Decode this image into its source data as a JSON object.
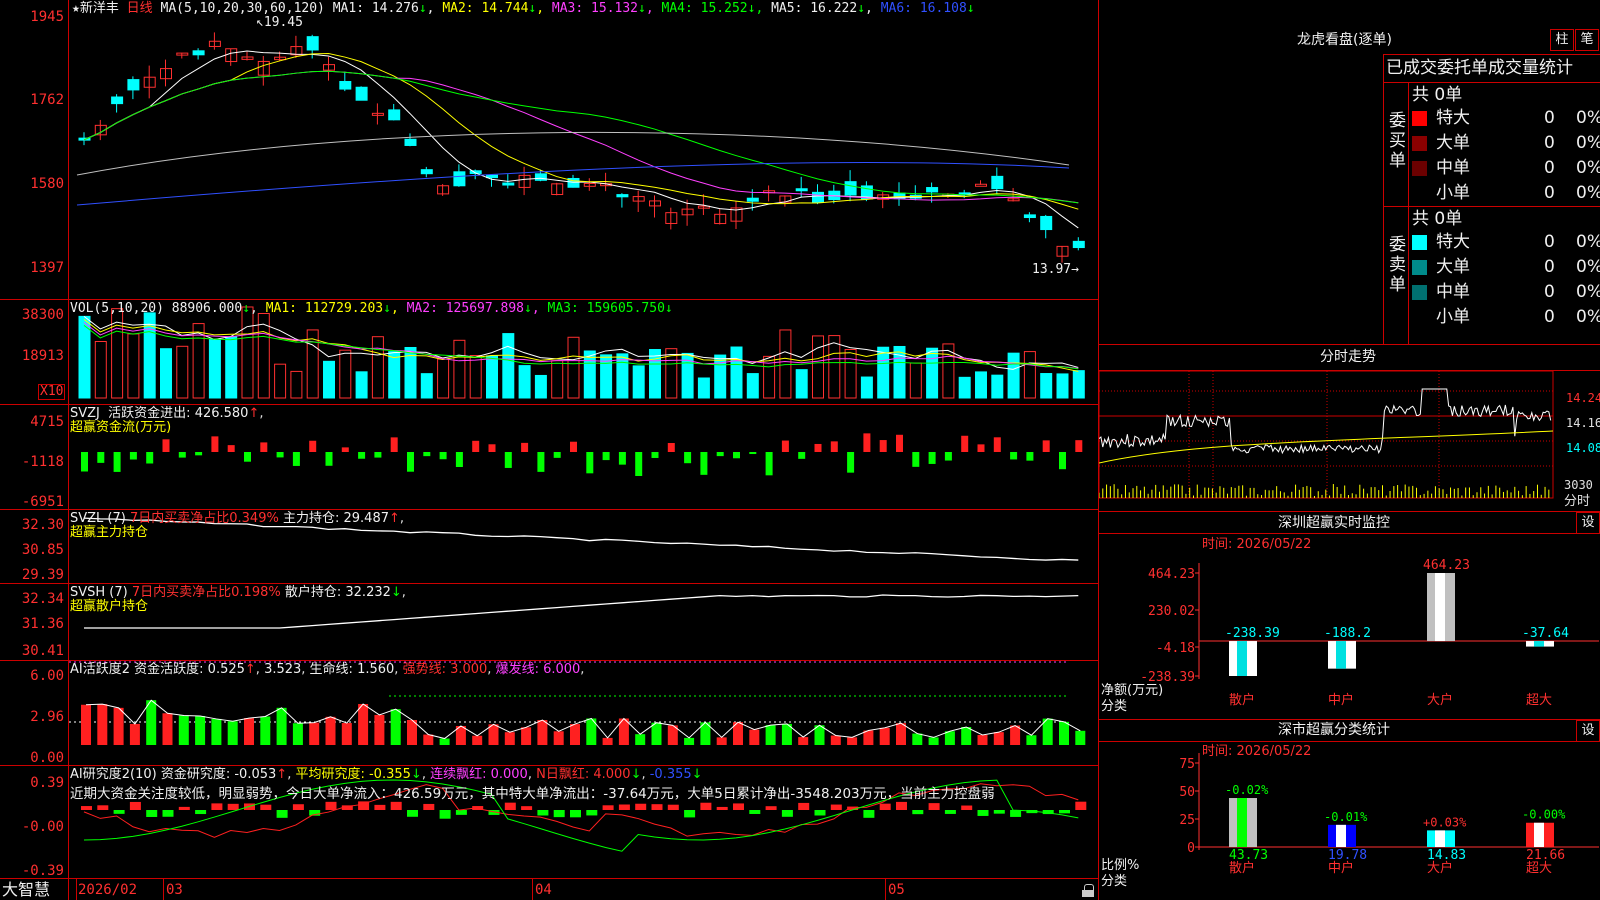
{
  "colors": {
    "up": "#ff3030",
    "down": "#00ffff",
    "grid": "#cc0000",
    "ma1": "#ffffff",
    "ma2": "#ffff00",
    "ma3": "#ff40ff",
    "ma4": "#00ff00",
    "ma5": "#c0c0c0",
    "ma6": "#3050ff"
  },
  "price_panel": {
    "star": "★",
    "name": "新洋丰",
    "period": "日线",
    "ma_label": "MA(5,10,20,30,60,120)",
    "ma": [
      {
        "label": "MA1:",
        "value": "14.276",
        "arrow": "↓"
      },
      {
        "label": "MA2:",
        "value": "14.744",
        "arrow": "↓"
      },
      {
        "label": "MA3:",
        "value": "15.132",
        "arrow": "↓"
      },
      {
        "label": "MA4:",
        "value": "15.252",
        "arrow": "↓"
      },
      {
        "label": "MA5:",
        "value": "16.222",
        "arrow": "↓"
      },
      {
        "label": "MA6:",
        "value": "16.108",
        "arrow": "↓"
      }
    ],
    "y_ticks": [
      "1945",
      "1762",
      "1580",
      "1397"
    ],
    "high_mark": "19.45",
    "low_mark": "13.97→"
  },
  "vol_panel": {
    "label": "VOL(5,10,20)",
    "value": "88906.000",
    "value_arrow": "↓",
    "ma": [
      {
        "label": "MA1:",
        "value": "112729.203",
        "arrow": "↓"
      },
      {
        "label": "MA2:",
        "value": "125697.898",
        "arrow": "↓"
      },
      {
        "label": "MA3:",
        "value": "159605.750",
        "arrow": "↓"
      }
    ],
    "y_ticks": [
      "38300",
      "18913"
    ],
    "unit": "X10"
  },
  "svzj_panel": {
    "label": "SVZJ",
    "field": "活跃资金进出:",
    "value": "426.580",
    "arrow": "↑",
    "subtitle": "超赢资金流(万元)",
    "y_ticks": [
      "4715",
      "-1118",
      "-6951"
    ]
  },
  "svzl_panel": {
    "label": "SVZL (7)",
    "ratio": "7日内买卖净占比0.349%",
    "field": "主力持仓:",
    "value": "29.487",
    "arrow": "↑",
    "subtitle": "超赢主力持仓",
    "y_ticks": [
      "32.30",
      "30.85",
      "29.39"
    ]
  },
  "svsh_panel": {
    "label": "SVSH (7)",
    "ratio": "7日内买卖净占比0.198%",
    "field": "散户持仓:",
    "value": "32.232",
    "arrow": "↓",
    "subtitle": "超赢散户持仓",
    "y_ticks": [
      "32.34",
      "31.36",
      "30.41"
    ]
  },
  "ai_active": {
    "label": "AI活跃度2",
    "field": "资金活跃度:",
    "value": "0.525",
    "arrow": "↑",
    "v2": "3.523",
    "field3": "生命线:",
    "v3": "1.560",
    "strong": "强势线: 3.000",
    "burst": "爆发线: 6.000",
    "y_ticks": [
      "6.00",
      "2.96",
      "0.00"
    ]
  },
  "ai_research": {
    "label": "AI研究度2(10)",
    "field": "资金研究度:",
    "value": "-0.053",
    "arrow": "↑",
    "field2": "平均研究度:",
    "v2": "-0.355",
    "a2": "↓",
    "field3": "连续飘红:",
    "v3": "0.000",
    "field4": "N日飘红:",
    "v4": "4.000",
    "a4": "↓",
    "v5": "-0.355",
    "a5": "↓",
    "comment": "近期大资金关注度较低，明显弱势，今日大单净流入：426.59万元，其中特大单净流出：-37.64万元，大单5日累计净出-3548.203万元，当前主力控盘弱",
    "y_ticks": [
      "0.39",
      "-0.00",
      "-0.39"
    ]
  },
  "date_axis": {
    "brand": "大智慧",
    "labels": [
      "2026/02",
      "03",
      "04",
      "05"
    ]
  },
  "lhb": {
    "title": "龙虎看盘(逐单)",
    "tab1": "柱",
    "tab2": "笔",
    "header": "已成交委托单成交量统计",
    "buy_group": "委买单",
    "sell_group": "委卖单",
    "buy_total": "共 0单",
    "sell_total": "共 0单",
    "buy_rows": [
      {
        "name": "特大",
        "count": "0",
        "pct": "0%",
        "color": "#ff0000"
      },
      {
        "name": "大单",
        "count": "0",
        "pct": "0%",
        "color": "#8b0000"
      },
      {
        "name": "中单",
        "count": "0",
        "pct": "0%",
        "color": "#6b0000"
      },
      {
        "name": "小单",
        "count": "0",
        "pct": "0%",
        "color": ""
      }
    ],
    "sell_rows": [
      {
        "name": "特大",
        "count": "0",
        "pct": "0%",
        "color": "#00ffff"
      },
      {
        "name": "大单",
        "count": "0",
        "pct": "0%",
        "color": "#008b8b"
      },
      {
        "name": "中单",
        "count": "0",
        "pct": "0%",
        "color": "#007070"
      },
      {
        "name": "小单",
        "count": "0",
        "pct": "0%",
        "color": ""
      }
    ]
  },
  "intraday": {
    "title": "分时走势",
    "y_ticks": [
      "14.24",
      "14.16",
      "14.08"
    ],
    "vol_tick": "3030",
    "vol_unit": "分时"
  },
  "sz_monitor": {
    "title": "深圳超赢实时监控",
    "set": "设",
    "time": "时间: 2026/05/22",
    "y_ticks": [
      "464.23",
      "230.02",
      "-4.18",
      "-238.39"
    ],
    "ylabel": "净额(万元)",
    "xlabel": "分类",
    "bars": [
      {
        "cat": "散户",
        "value": -238.39,
        "label": "-238.39"
      },
      {
        "cat": "中户",
        "value": -188.2,
        "label": "-188.2"
      },
      {
        "cat": "大户",
        "value": 464.23,
        "label": "464.23"
      },
      {
        "cat": "超大",
        "value": -37.64,
        "label": "-37.64"
      }
    ]
  },
  "sz_class": {
    "title": "深市超赢分类统计",
    "set": "设",
    "time": "时间: 2026/05/22",
    "y_ticks": [
      "75",
      "50",
      "25",
      "0"
    ],
    "ylabel": "比例%",
    "xlabel": "分类",
    "bars": [
      {
        "cat": "散户",
        "value": 43.73,
        "label": "43.73",
        "delta": "-0.02%"
      },
      {
        "cat": "中户",
        "value": 19.78,
        "label": "19.78",
        "delta": "-0.01%"
      },
      {
        "cat": "大户",
        "value": 14.83,
        "label": "14.83",
        "delta": "+0.03%"
      },
      {
        "cat": "超大",
        "value": 21.66,
        "label": "21.66",
        "delta": "-0.00%"
      }
    ]
  },
  "chart_data": [
    {
      "type": "line",
      "title": "新洋丰 日线",
      "y_range": [
        13.97,
        19.45
      ],
      "series": [
        {
          "name": "MA1",
          "values": [
            14.276
          ]
        },
        {
          "name": "MA2",
          "values": [
            14.744
          ]
        },
        {
          "name": "MA3",
          "values": [
            15.132
          ]
        },
        {
          "name": "MA4",
          "values": [
            15.252
          ]
        },
        {
          "name": "MA5",
          "values": [
            16.222
          ]
        },
        {
          "name": "MA6",
          "values": [
            16.108
          ]
        }
      ]
    },
    {
      "type": "bar",
      "title": "深圳超赢实时监控",
      "categories": [
        "散户",
        "中户",
        "大户",
        "超大"
      ],
      "values": [
        -238.39,
        -188.2,
        464.23,
        -37.64
      ],
      "ylabel": "净额(万元)",
      "xlabel": "分类",
      "ylim": [
        -238.39,
        464.23
      ]
    },
    {
      "type": "bar",
      "title": "深市超赢分类统计",
      "categories": [
        "散户",
        "中户",
        "大户",
        "超大"
      ],
      "values": [
        43.73,
        19.78,
        14.83,
        21.66
      ],
      "ylabel": "比例%",
      "xlabel": "分类",
      "ylim": [
        0,
        75
      ]
    }
  ]
}
